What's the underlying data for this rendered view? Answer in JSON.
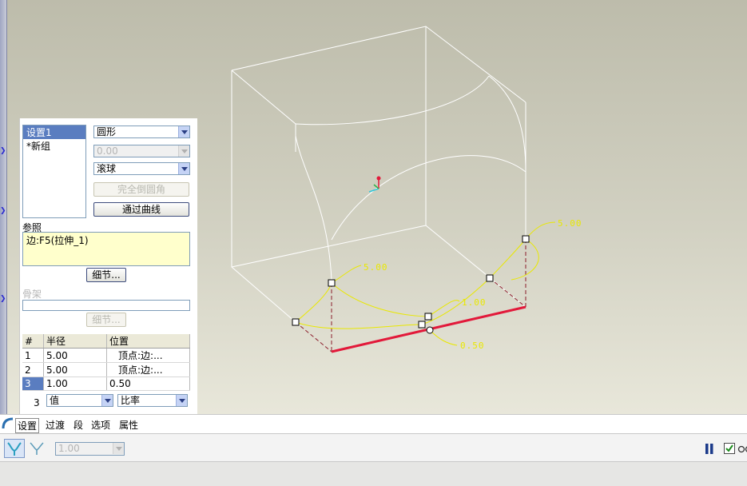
{
  "panel": {
    "sets": [
      "设置1",
      "*新组"
    ],
    "shape_combo": "圆形",
    "radius_combo": "0.00",
    "method_combo": "滚球",
    "full_round_button": "完全倒圆角",
    "through_curve_button": "通过曲线",
    "references_label": "参照",
    "reference_value": "边:F5(拉伸_1)",
    "details_button": "细节...",
    "spine_label": "骨架",
    "spine_details_button": "细节...",
    "table": {
      "headers": [
        "#",
        "半径",
        "位置"
      ],
      "rows": [
        {
          "n": "1",
          "radius": "5.00",
          "location": "顶点:边:..."
        },
        {
          "n": "2",
          "radius": "5.00",
          "location": "顶点:边:..."
        },
        {
          "n": "3",
          "radius": "1.00",
          "location": "0.50"
        }
      ]
    },
    "row_index": "3",
    "value_combo": "值",
    "ratio_combo": "比率"
  },
  "dimensions": {
    "d1": "5.00",
    "d2": "5.00",
    "d3": "1.00",
    "d4": "0.50"
  },
  "tabs": [
    "设置",
    "过渡",
    "段",
    "选项",
    "属性"
  ],
  "toolbar": {
    "value_combo": "1.00"
  },
  "colors": {
    "accent": "#e2193a",
    "dimension": "#e9e800",
    "selection": "#5a7dc0"
  }
}
